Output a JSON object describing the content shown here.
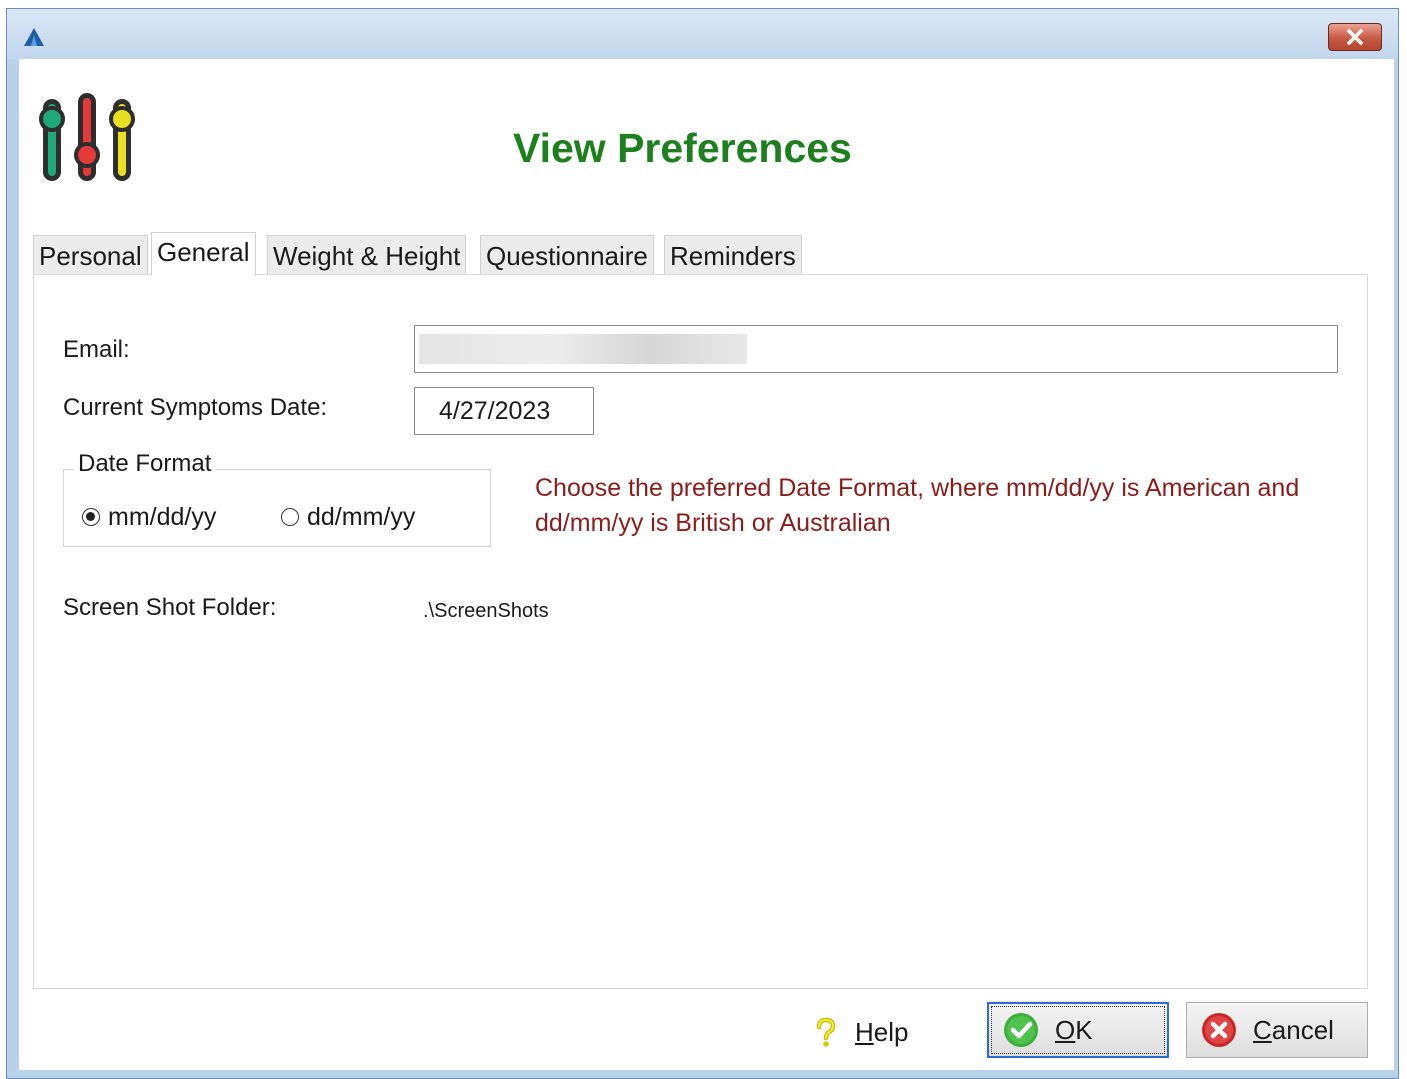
{
  "window": {
    "title": ""
  },
  "dialog": {
    "title": "View Preferences"
  },
  "tabs": [
    {
      "label": "Personal",
      "active": false
    },
    {
      "label": "General",
      "active": true
    },
    {
      "label": "Weight & Height",
      "active": false
    },
    {
      "label": "Questionnaire",
      "active": false
    },
    {
      "label": "Reminders",
      "active": false
    }
  ],
  "form": {
    "email_label": "Email:",
    "email_value": "",
    "symptoms_date_label": "Current Symptoms Date:",
    "symptoms_date_value": "4/27/2023",
    "date_format": {
      "legend": "Date Format",
      "options": [
        {
          "label": "mm/dd/yy",
          "selected": true
        },
        {
          "label": "dd/mm/yy",
          "selected": false
        }
      ],
      "hint": "Choose the preferred Date Format, where mm/dd/yy is American and dd/mm/yy is British or Australian"
    },
    "screenshot_folder_label": "Screen Shot Folder:",
    "screenshot_folder_value": ".\\ScreenShots"
  },
  "buttons": {
    "help": "Help",
    "ok": "OK",
    "cancel": "Cancel"
  },
  "icons": {
    "app": "app-logo-icon",
    "close": "close-icon",
    "header": "sliders-icon",
    "help": "question-mark-icon",
    "ok": "green-check-icon",
    "cancel": "red-x-icon"
  },
  "colors": {
    "title": "#1d7f1d",
    "hint": "#8b1c1c",
    "ok_border": "#2b6bd6"
  }
}
